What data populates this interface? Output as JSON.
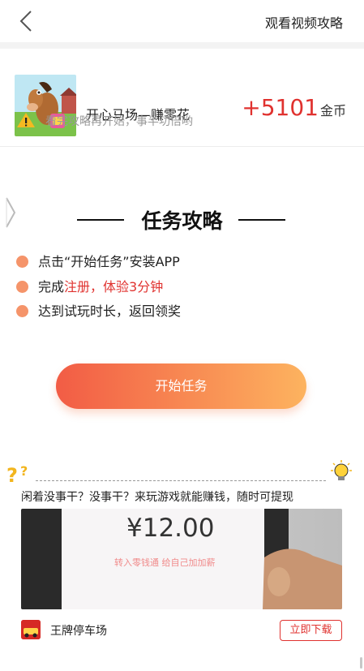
{
  "header": {
    "video_guide": "观看视频攻略"
  },
  "app": {
    "name": "开心马场—赚零花",
    "reward_amount": "+5101",
    "reward_unit": "金币"
  },
  "tip": "看完攻略再开始，事半功倍哟",
  "guide": {
    "title": "任务攻略",
    "steps": [
      {
        "prefix": "点击“开始任务”安装APP",
        "highlight": ""
      },
      {
        "prefix": "完成",
        "highlight": "注册，体验3分钟"
      },
      {
        "prefix": "达到试玩时长，返回领奖",
        "highlight": ""
      }
    ]
  },
  "start_button": "开始任务",
  "promo": {
    "text": "闲着没事干？没事干？来玩游戏就能赚钱，随时可提现",
    "image_amount": "¥12.00",
    "image_caption": "转入零钱通 给自己加加薪",
    "game_name": "王牌停车场",
    "download_label": "立即下载"
  },
  "colors": {
    "accent": "#e0322f",
    "button_start": "#f25c45",
    "button_end": "#fdb35f",
    "dot": "#f5946a"
  },
  "icons": [
    "back-arrow-icon",
    "warning-icon",
    "side-expand-icon",
    "question-marks-icon",
    "lightbulb-icon"
  ]
}
